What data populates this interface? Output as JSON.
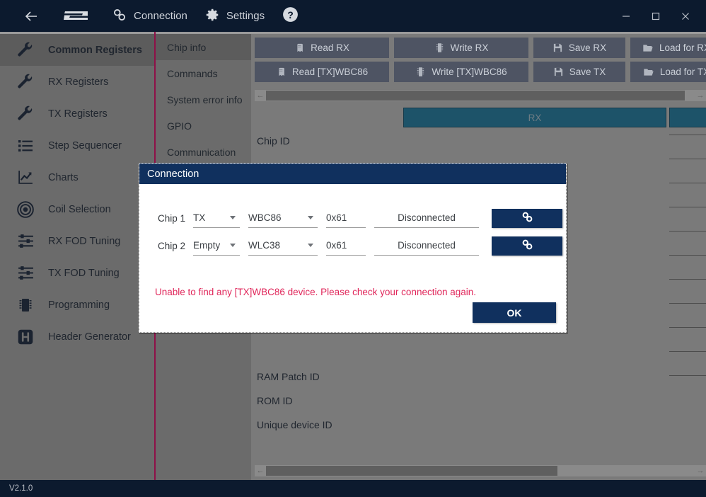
{
  "topbar": {
    "back_icon": "back-arrow-icon",
    "logo_icon": "st-logo-icon",
    "connection_label": "Connection",
    "connection_icon": "chain-link-icon",
    "settings_label": "Settings",
    "settings_icon": "gear-icon",
    "help_icon": "question-circle-icon",
    "minimize_icon": "minimize-icon",
    "maximize_icon": "maximize-icon",
    "close_icon": "close-icon",
    "background": "#0c1a2e"
  },
  "sidebar": {
    "accent_color": "#8e1048",
    "items": [
      {
        "label": "Common Registers",
        "icon": "wrench-icon",
        "active": true
      },
      {
        "label": "RX Registers",
        "icon": "wrench-icon",
        "active": false
      },
      {
        "label": "TX Registers",
        "icon": "wrench-icon",
        "active": false
      },
      {
        "label": "Step Sequencer",
        "icon": "list-icon",
        "active": false
      },
      {
        "label": "Charts",
        "icon": "chart-line-icon",
        "active": false
      },
      {
        "label": "Coil Selection",
        "icon": "coil-target-icon",
        "active": false
      },
      {
        "label": "RX FOD Tuning",
        "icon": "sliders-icon",
        "active": false
      },
      {
        "label": "TX FOD Tuning",
        "icon": "sliders-icon",
        "active": false
      },
      {
        "label": "Programming",
        "icon": "chip-icon",
        "active": false
      },
      {
        "label": "Header Generator",
        "icon": "h-square-icon",
        "active": false
      }
    ]
  },
  "tabs": {
    "items": [
      {
        "label": "Chip info",
        "active": true
      },
      {
        "label": "Commands",
        "active": false
      },
      {
        "label": "System error info",
        "active": false
      },
      {
        "label": "GPIO",
        "active": false
      },
      {
        "label": "Communication",
        "active": false
      }
    ]
  },
  "toolbar": {
    "row1": [
      {
        "label": "Read RX",
        "icon": "book-icon"
      },
      {
        "label": "Write RX",
        "icon": "chip-write-icon"
      },
      {
        "label": "Save RX",
        "icon": "floppy-save-icon"
      },
      {
        "label": "Load for RX",
        "icon": "folder-open-icon"
      }
    ],
    "row2": [
      {
        "label": "Read [TX]WBC86",
        "icon": "book-icon"
      },
      {
        "label": "Write [TX]WBC86",
        "icon": "chip-write-icon"
      },
      {
        "label": "Save TX",
        "icon": "floppy-save-icon"
      },
      {
        "label": "Load for TX",
        "icon": "folder-open-icon"
      }
    ]
  },
  "table": {
    "columns": [
      {
        "label": "RX",
        "color": "#1d5369"
      },
      {
        "label": "",
        "color": "#1d5369"
      }
    ],
    "rows": [
      {
        "label": "Chip ID"
      },
      {
        "label": "RAM Patch ID"
      },
      {
        "label": "ROM ID"
      },
      {
        "label": "Unique device ID"
      }
    ]
  },
  "scrollbars": {
    "left_arrow": "←",
    "right_arrow": "→"
  },
  "dialog": {
    "title": "Connection",
    "title_bg": "#10305e",
    "rows": [
      {
        "chip_label": "Chip 1",
        "role": "TX",
        "device": "WBC86",
        "address": "0x61",
        "status": "Disconnected",
        "connect_icon": "chain-link-icon"
      },
      {
        "chip_label": "Chip 2",
        "role": "Empty",
        "device": "WLC38",
        "address": "0x61",
        "status": "Disconnected",
        "connect_icon": "chain-link-icon"
      }
    ],
    "error_message": "Unable to find any [TX]WBC86 device. Please check your connection again.",
    "error_color": "#e0265a",
    "ok_label": "OK"
  },
  "statusbar": {
    "version": "V2.1.0"
  }
}
